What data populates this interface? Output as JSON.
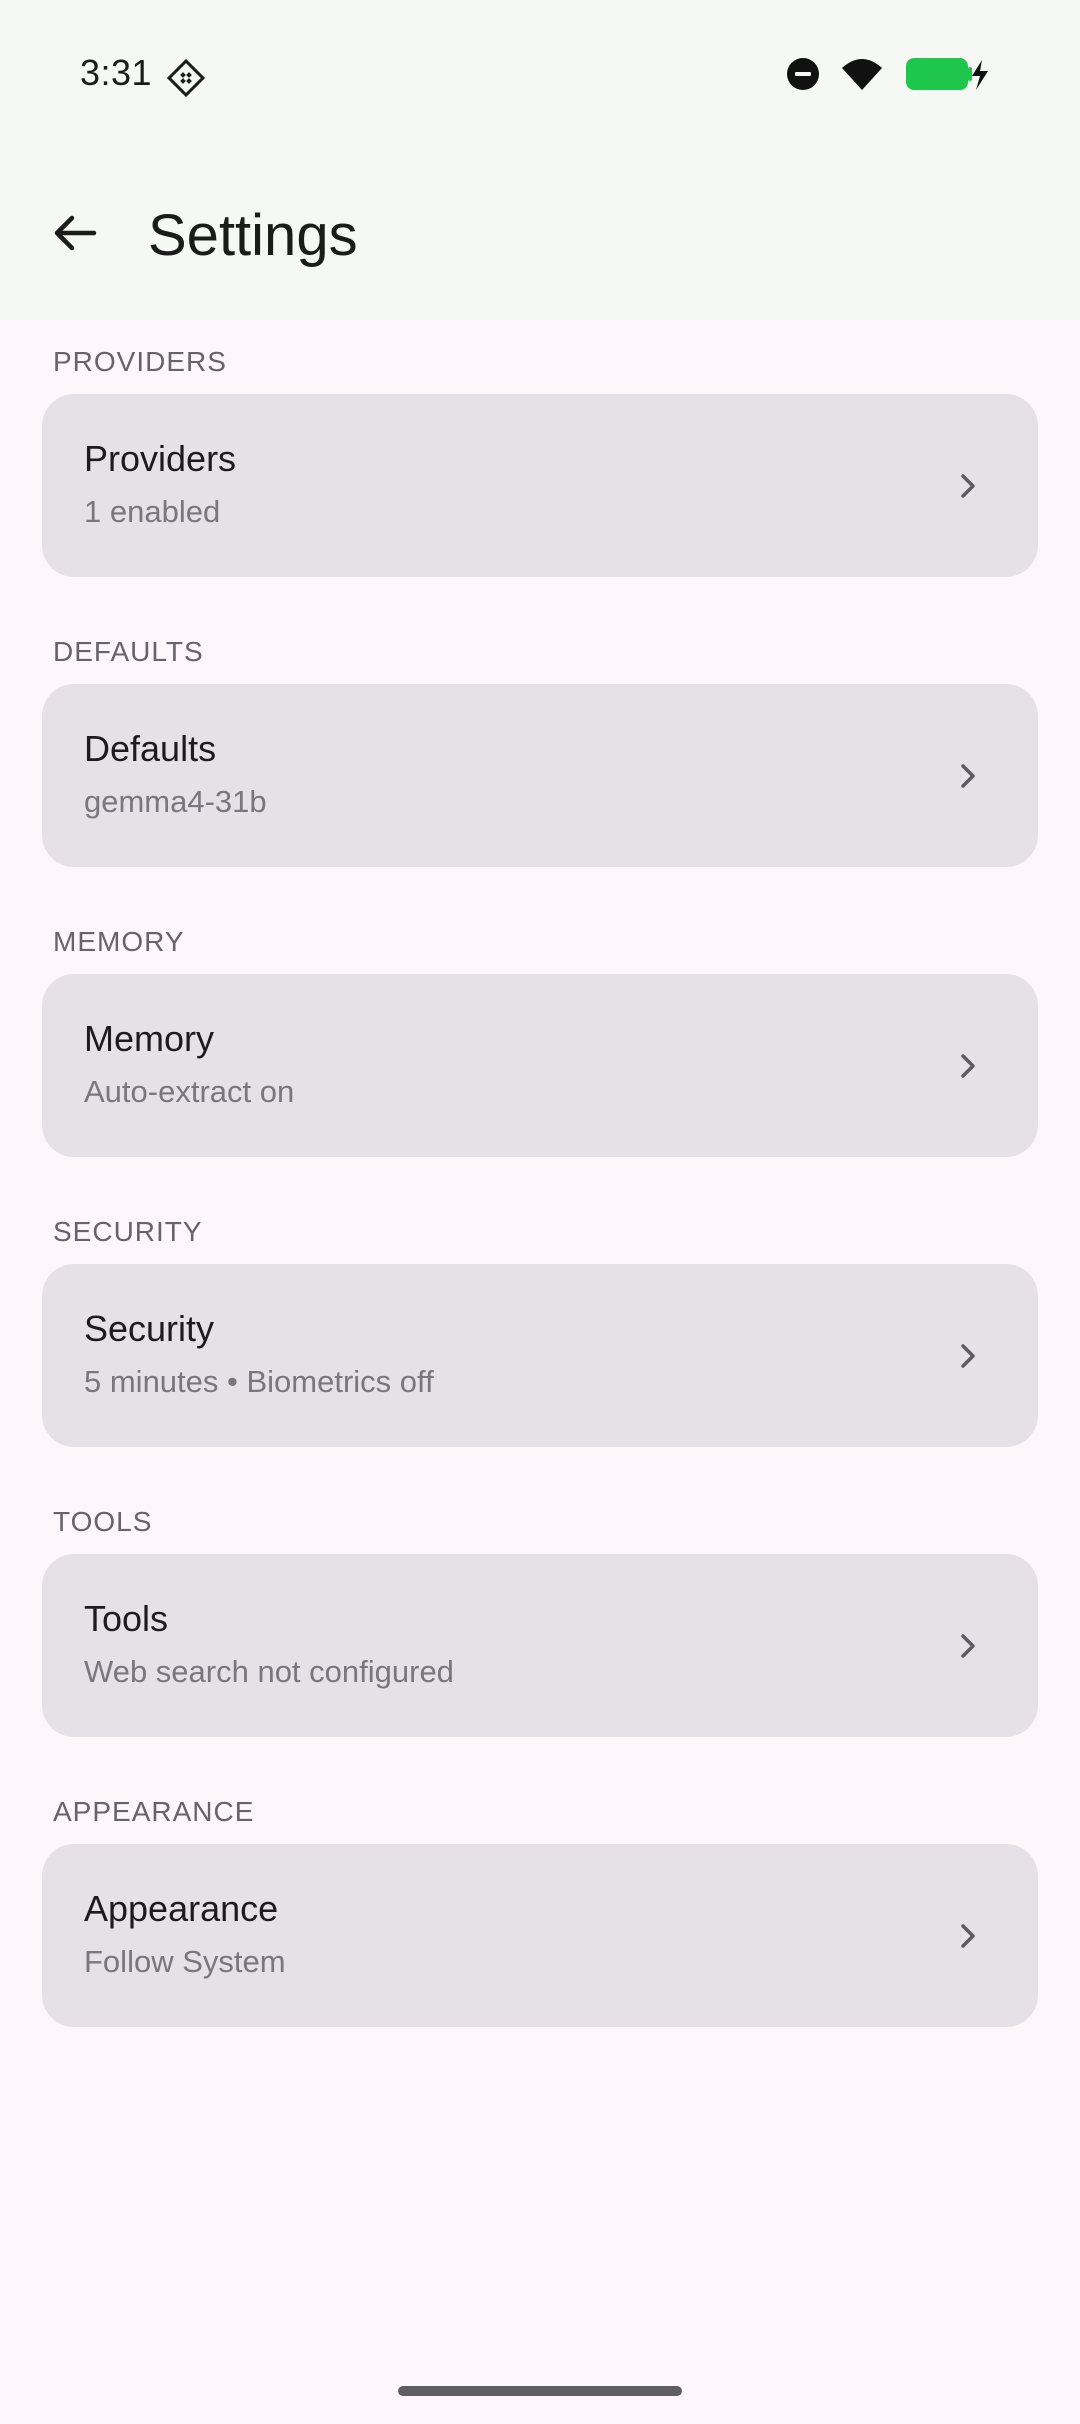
{
  "status_bar": {
    "time": "3:31",
    "time_icon": "gem-icon",
    "icons": [
      "do-not-disturb-icon",
      "wifi-icon",
      "battery-charging-icon"
    ],
    "battery_color": "#1EC74B"
  },
  "app_bar": {
    "back_icon": "arrow-back-icon",
    "title": "Settings"
  },
  "sections": [
    {
      "header": "PROVIDERS",
      "title": "Providers",
      "subtitle": "1 enabled"
    },
    {
      "header": "DEFAULTS",
      "title": "Defaults",
      "subtitle": "gemma4-31b"
    },
    {
      "header": "MEMORY",
      "title": "Memory",
      "subtitle": "Auto-extract on"
    },
    {
      "header": "SECURITY",
      "title": "Security",
      "subtitle": "5 minutes • Biometrics off"
    },
    {
      "header": "TOOLS",
      "title": "Tools",
      "subtitle": "Web search not configured"
    },
    {
      "header": "APPEARANCE",
      "title": "Appearance",
      "subtitle": "Follow System"
    }
  ],
  "colors": {
    "background": "#FDF7FC",
    "top_bar": "#F6F8F6",
    "card": "#E6E1E6",
    "section_header": "#66636A"
  }
}
